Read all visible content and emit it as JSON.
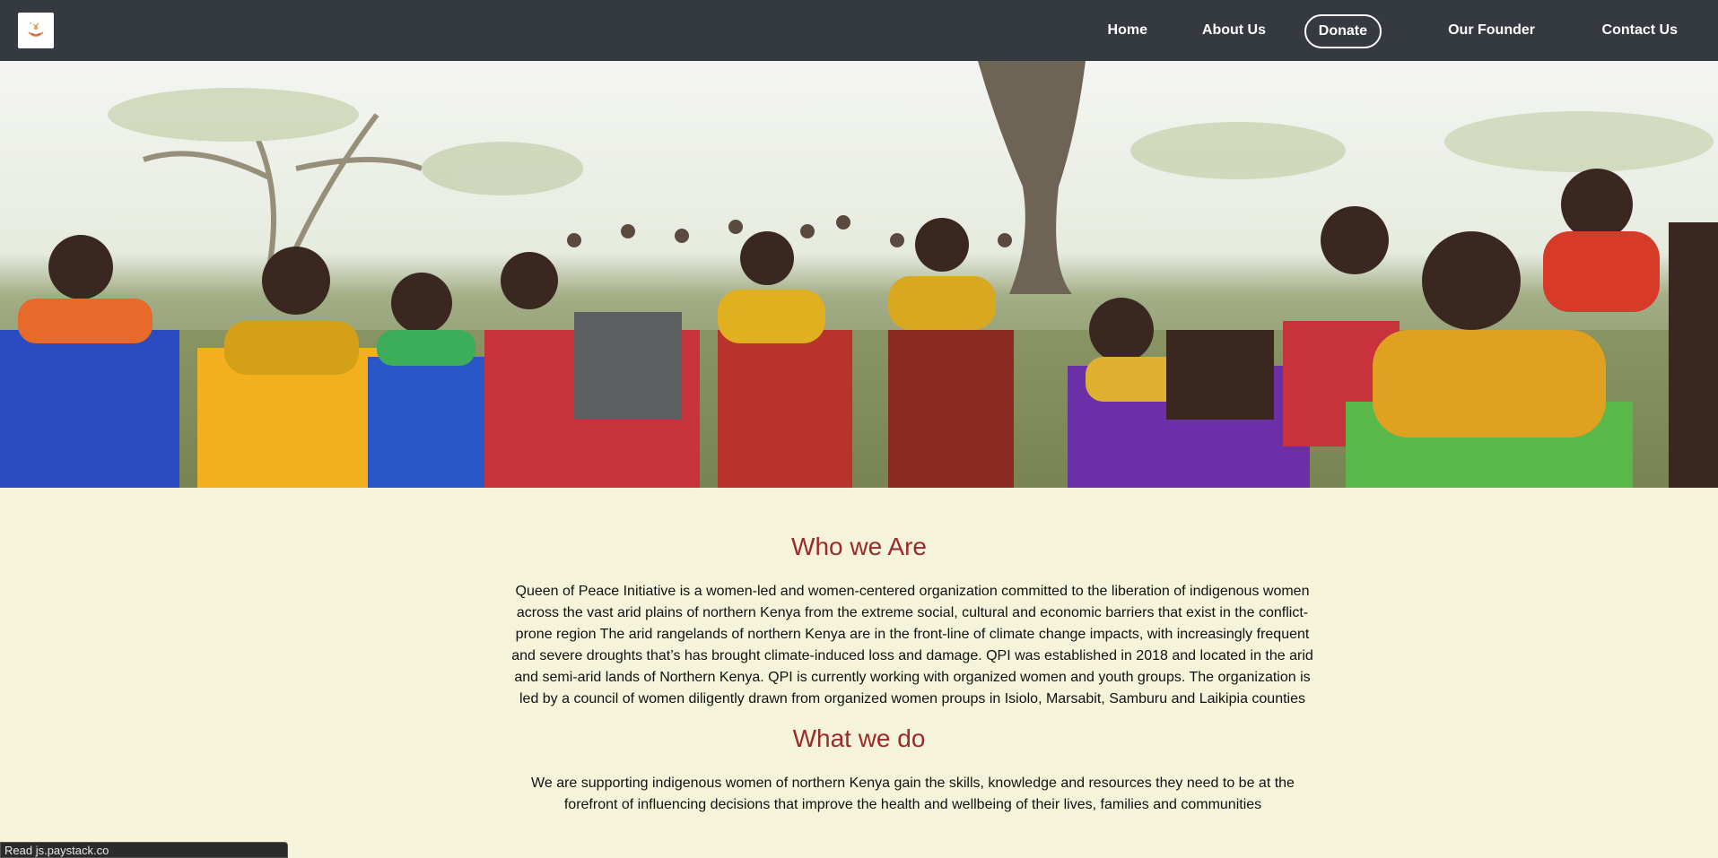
{
  "nav": {
    "logo_icon": "dove-logo-icon",
    "items": [
      {
        "label": "Home"
      },
      {
        "label": "About Us"
      },
      {
        "label": "Donate"
      },
      {
        "label": "Our Founder"
      },
      {
        "label": "Contact Us"
      }
    ]
  },
  "hero": {
    "image": "group-of-women-gathering-photo"
  },
  "who": {
    "title": "Who we Are",
    "body": "Queen of Peace Initiative is a women-led and women-centered organization committed to the liberation of indigenous women across the vast arid plains of northern Kenya from the extreme social, cultural and economic barriers that exist in the conflict-prone region The arid rangelands of northern Kenya are in the front-line of climate change impacts, with increasingly frequent and severe droughts that’s has brought climate-induced loss and damage. QPI was established in 2018 and located in the arid and semi-arid lands of Northern Kenya. QPI is currently working with organized women and youth groups. The organization is led by a council of women diligently drawn from organized women proups in Isiolo, Marsabit, Samburu and Laikipia counties"
  },
  "what": {
    "title": "What we do",
    "body": "We are supporting indigenous women of northern Kenya gain the skills, knowledge and resources they need to be at the forefront of influencing decisions that improve the health and wellbeing of their lives, families and communities"
  },
  "status": {
    "text": "Read js.paystack.co"
  },
  "colors": {
    "navbar": "#343a40",
    "background": "#f5f4da",
    "heading": "#9b2a2a"
  }
}
